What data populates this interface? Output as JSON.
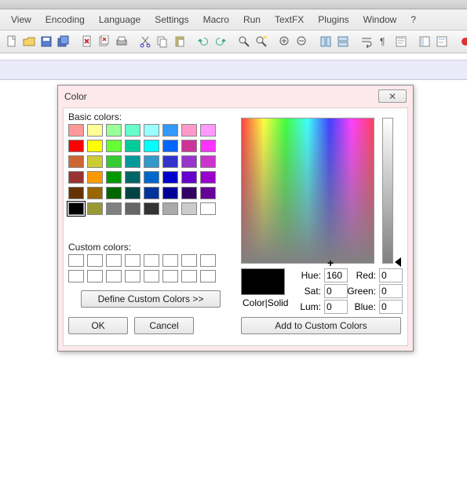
{
  "topleft": "++",
  "menu": [
    "View",
    "Encoding",
    "Language",
    "Settings",
    "Macro",
    "Run",
    "TextFX",
    "Plugins",
    "Window",
    "?"
  ],
  "dialog": {
    "title": "Color",
    "close_glyph": "⌹",
    "basic_label": "Basic colors:",
    "custom_label": "Custom colors:",
    "define_label": "Define Custom Colors >>",
    "ok_label": "OK",
    "cancel_label": "Cancel",
    "colorsolid": "Color|Solid",
    "addcustom": "Add to Custom Colors",
    "fields": {
      "hue_label": "Hue:",
      "hue": "160",
      "sat_label": "Sat:",
      "sat": "0",
      "lum_label": "Lum:",
      "lum": "0",
      "red_label": "Red:",
      "red": "0",
      "green_label": "Green:",
      "green": "0",
      "blue_label": "Blue:",
      "blue": "0"
    },
    "basic_swatches": [
      [
        "#ff9999",
        "#ffff99",
        "#99ff99",
        "#66ffcc",
        "#99ffff",
        "#3399ff",
        "#ff99cc",
        "#ff99ff"
      ],
      [
        "#ff0000",
        "#ffff00",
        "#66ff33",
        "#00cc99",
        "#00ffff",
        "#0066ff",
        "#cc3399",
        "#ff33ff"
      ],
      [
        "#cc6633",
        "#cccc33",
        "#33cc33",
        "#009999",
        "#3399cc",
        "#3333cc",
        "#9933cc",
        "#cc33cc"
      ],
      [
        "#993333",
        "#ff9900",
        "#009900",
        "#006666",
        "#0066cc",
        "#0000cc",
        "#6600cc",
        "#9900cc"
      ],
      [
        "#663300",
        "#996600",
        "#006600",
        "#004444",
        "#003399",
        "#000099",
        "#330066",
        "#660099"
      ],
      [
        "#000000",
        "#999933",
        "#808080",
        "#666666",
        "#333333",
        "#aaaaaa",
        "#cccccc",
        "#ffffff"
      ]
    ]
  }
}
